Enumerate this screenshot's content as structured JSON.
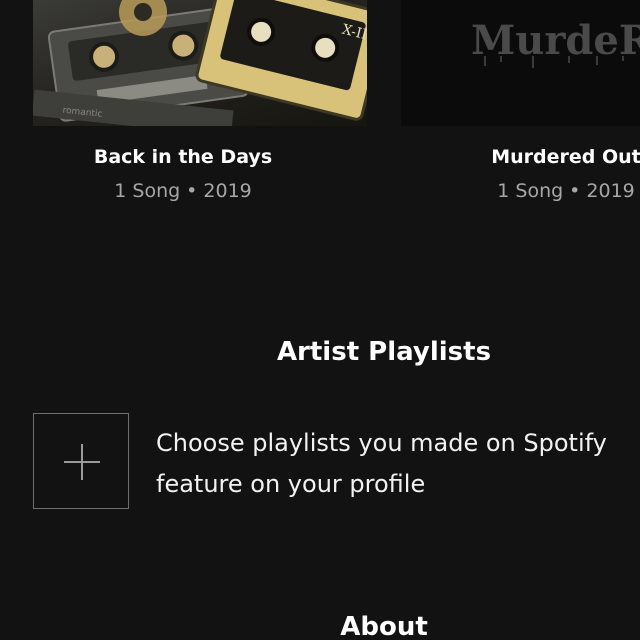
{
  "releases": [
    {
      "title": "Back in the Days",
      "songs": "1 Song",
      "year": "2019",
      "cover_text": "X-II",
      "cover_brand": "romantic"
    },
    {
      "title": "Murdered Out",
      "songs": "1 Song",
      "year": "2019",
      "cover_text": "MurdeRed"
    }
  ],
  "separator": "•",
  "artist_playlists": {
    "title": "Artist Playlists",
    "prompt_line1": "Choose playlists you made on Spotify",
    "prompt_line2": "feature on your profile",
    "add_icon": "plus-icon"
  },
  "about": {
    "title": "About"
  },
  "colors": {
    "background": "#121212",
    "text_primary": "#ffffff",
    "text_secondary": "#a7a7a7",
    "box_border": "#6f6f6f"
  }
}
